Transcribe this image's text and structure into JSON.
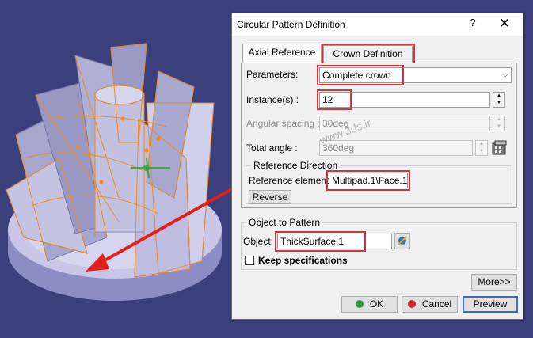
{
  "dialog": {
    "title": "Circular Pattern Definition",
    "help_label": "?",
    "close_label": "✕",
    "tabs": [
      {
        "label": "Axial Reference"
      },
      {
        "label": "Crown Definition"
      }
    ],
    "parameters": {
      "label": "Parameters:",
      "value": "Complete crown"
    },
    "instances": {
      "label": "Instance(s) :",
      "value": "12"
    },
    "angular_spacing": {
      "label": "Angular spacing :",
      "value": "30deg"
    },
    "total_angle": {
      "label": "Total angle :",
      "value": "360deg"
    },
    "reference_direction": {
      "title": "Reference Direction",
      "element_label": "Reference element:",
      "element_value": "Multipad.1\\Face.1",
      "reverse_label": "Reverse"
    },
    "object_to_pattern": {
      "title": "Object to Pattern",
      "object_label": "Object:",
      "object_value": "ThickSurface.1",
      "keep_label": "Keep specifications"
    },
    "more_label": "More>>",
    "ok_label": "OK",
    "cancel_label": "Cancel",
    "preview_label": "Preview"
  },
  "watermark": "www.3ds.ir",
  "colors": {
    "background": "#3b3f7c",
    "highlight": "#d9323a",
    "arrow": "#e0201c",
    "selection": "#f08a1c",
    "ok_dot": "#2e9c3e",
    "cancel_dot": "#c8262c"
  }
}
